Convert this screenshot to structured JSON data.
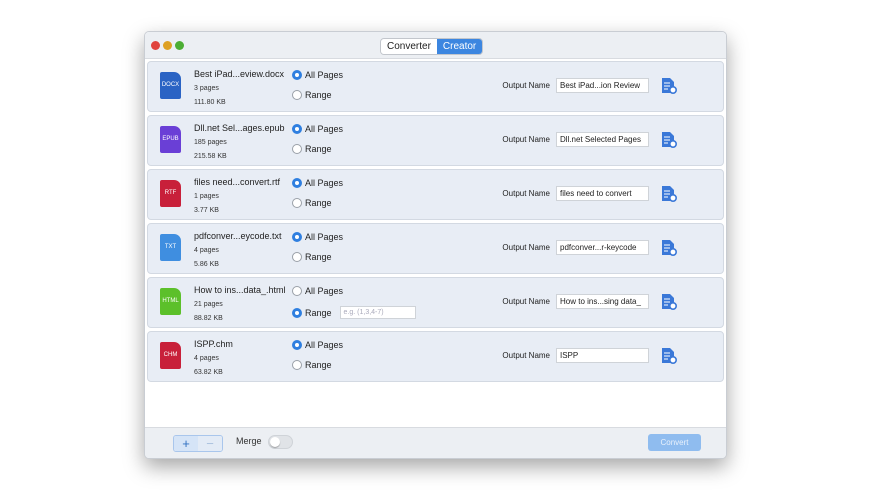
{
  "tabs": [
    {
      "label": "Converter",
      "active": false
    },
    {
      "label": "Creator",
      "active": true
    }
  ],
  "labels": {
    "all_pages": "All Pages",
    "range": "Range",
    "output_name": "Output Name",
    "range_placeholder": "e.g. (1,3,4-7)"
  },
  "files": [
    {
      "name": "Best iPad...eview.docx",
      "pages": "3 pages",
      "size": "111.80 KB",
      "type": "DOCX",
      "color": "#2a63c4",
      "selection": "all",
      "output": "Best iPad...ion Review"
    },
    {
      "name": "Dll.net Sel...ages.epub",
      "pages": "185 pages",
      "size": "215.58 KB",
      "type": "EPUB",
      "color": "#6a3fd6",
      "selection": "all",
      "output": "Dll.net Selected Pages"
    },
    {
      "name": "files need...convert.rtf",
      "pages": "1 pages",
      "size": "3.77 KB",
      "type": "RTF",
      "color": "#c8203a",
      "selection": "all",
      "output": "files need to convert"
    },
    {
      "name": "pdfconver...eycode.txt",
      "pages": "4 pages",
      "size": "5.86 KB",
      "type": "TXT",
      "color": "#3f8ee0",
      "selection": "all",
      "output": "pdfconver...r-keycode"
    },
    {
      "name": "How to ins...data_.html",
      "pages": "21 pages",
      "size": "88.82 KB",
      "type": "HTML",
      "color": "#5cc02a",
      "selection": "range",
      "output": "How to ins...sing data_"
    },
    {
      "name": "ISPP.chm",
      "pages": "4 pages",
      "size": "63.82 KB",
      "type": "CHM",
      "color": "#c8203a",
      "selection": "all",
      "output": "ISPP"
    }
  ],
  "bottom": {
    "add": "+",
    "remove": "−",
    "merge_label": "Merge",
    "merge_on": false,
    "convert": "Convert"
  }
}
